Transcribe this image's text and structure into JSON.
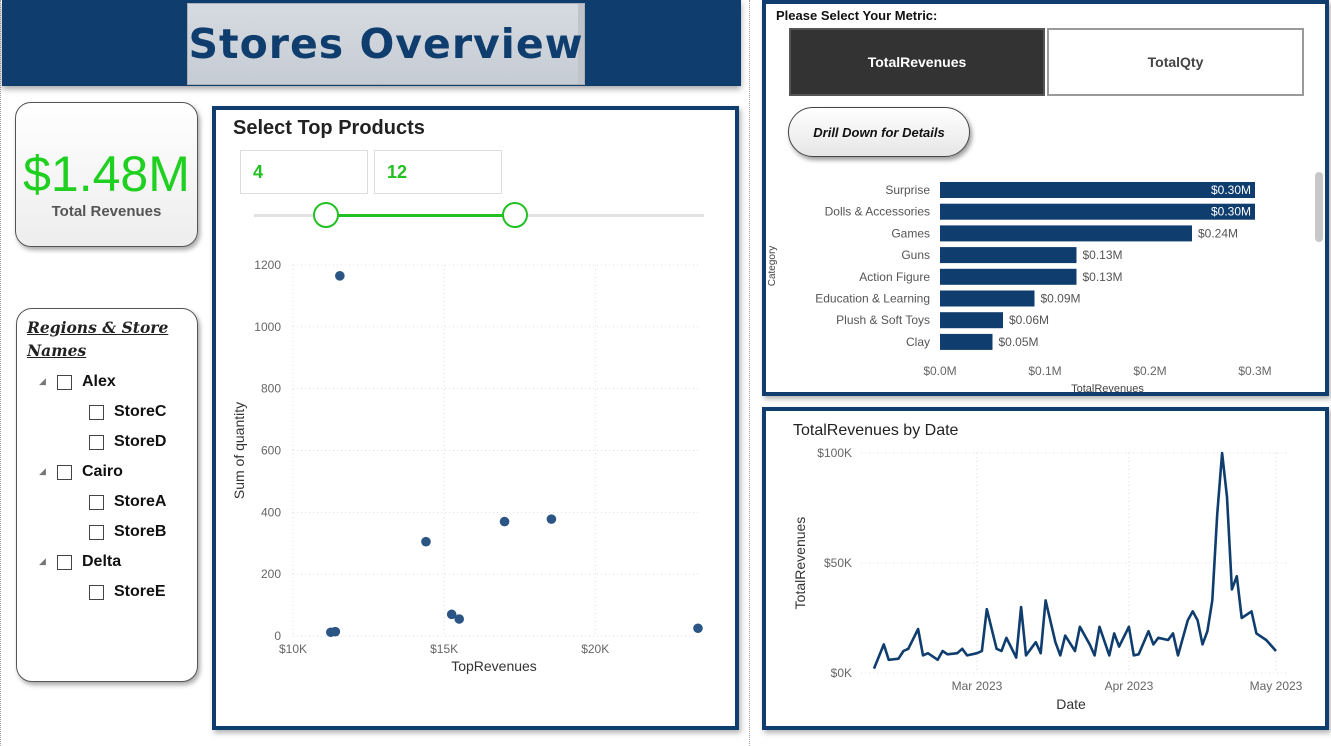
{
  "header": {
    "title": "Stores Overview"
  },
  "kpi": {
    "value": "$1.48M",
    "label": "Total Revenues"
  },
  "slicer": {
    "title": "Regions & Store Names",
    "regions": [
      {
        "name": "Alex",
        "stores": [
          "StoreC",
          "StoreD"
        ]
      },
      {
        "name": "Cairo",
        "stores": [
          "StoreA",
          "StoreB"
        ]
      },
      {
        "name": "Delta",
        "stores": [
          "StoreE"
        ]
      }
    ]
  },
  "top_products": {
    "title": "Select Top Products",
    "range_min": "4",
    "range_max": "12",
    "slider_min_fraction": 0.16,
    "slider_max_fraction": 0.58
  },
  "metric_selector": {
    "prompt": "Please Select Your Metric:",
    "options": [
      "TotalRevenues",
      "TotalQty"
    ],
    "selected": "TotalRevenues",
    "drill_label": "Drill Down for Details"
  },
  "colors": {
    "brand": "#0f3d6e",
    "accent": "#22c022",
    "point": "#2b5584"
  },
  "chart_data": [
    {
      "type": "scatter",
      "xlabel": "TopRevenues",
      "ylabel": "Sum of quantity",
      "xlim": [
        10000,
        23500
      ],
      "ylim": [
        0,
        1200
      ],
      "x_ticks": [
        10000,
        15000,
        20000
      ],
      "x_tick_labels": [
        "$10K",
        "$15K",
        "$20K"
      ],
      "y_ticks": [
        0,
        200,
        400,
        600,
        800,
        1000,
        1200
      ],
      "y_tick_labels": [
        "0",
        "200",
        "400",
        "600",
        "800",
        "1000",
        "1200"
      ],
      "grid": true,
      "points": [
        {
          "x": 11550,
          "y": 1165
        },
        {
          "x": 14400,
          "y": 305
        },
        {
          "x": 17000,
          "y": 370
        },
        {
          "x": 18550,
          "y": 378
        },
        {
          "x": 11250,
          "y": 12
        },
        {
          "x": 11400,
          "y": 14
        },
        {
          "x": 15250,
          "y": 70
        },
        {
          "x": 15500,
          "y": 55
        },
        {
          "x": 23400,
          "y": 25
        }
      ]
    },
    {
      "type": "bar",
      "orientation": "horizontal",
      "xlabel": "TotalRevenues",
      "ylabel": "Category",
      "categories": [
        "Surprise",
        "Dolls & Accessories",
        "Games",
        "Guns",
        "Action Figure",
        "Education & Learning",
        "Plush & Soft Toys",
        "Clay"
      ],
      "values": [
        0.3,
        0.3,
        0.24,
        0.13,
        0.13,
        0.09,
        0.06,
        0.05
      ],
      "value_labels": [
        "$0.30M",
        "$0.30M",
        "$0.24M",
        "$0.13M",
        "$0.13M",
        "$0.09M",
        "$0.06M",
        "$0.05M"
      ],
      "unit": "$M",
      "xlim": [
        0,
        0.3
      ],
      "x_ticks": [
        0,
        0.1,
        0.2,
        0.3
      ],
      "x_tick_labels": [
        "$0.0M",
        "$0.1M",
        "$0.2M",
        "$0.3M"
      ]
    },
    {
      "type": "line",
      "title": "TotalRevenues by Date",
      "xlabel": "Date",
      "ylabel": "TotalRevenues",
      "xlim": [
        "2023-02-08",
        "2023-05-01"
      ],
      "ylim": [
        0,
        100000
      ],
      "x_ticks": [
        "2023-03-01",
        "2023-04-01",
        "2023-05-01"
      ],
      "x_tick_labels": [
        "Mar 2023",
        "Apr 2023",
        "May 2023"
      ],
      "y_ticks": [
        0,
        50000,
        100000
      ],
      "y_tick_labels": [
        "$0K",
        "$50K",
        "$100K"
      ],
      "x": [
        "2023-02-08",
        "2023-02-10",
        "2023-02-11",
        "2023-02-13",
        "2023-02-14",
        "2023-02-15",
        "2023-02-17",
        "2023-02-18",
        "2023-02-19",
        "2023-02-21",
        "2023-02-22",
        "2023-02-23",
        "2023-02-25",
        "2023-02-26",
        "2023-02-27",
        "2023-03-01",
        "2023-03-02",
        "2023-03-03",
        "2023-03-05",
        "2023-03-06",
        "2023-03-07",
        "2023-03-09",
        "2023-03-10",
        "2023-03-11",
        "2023-03-13",
        "2023-03-14",
        "2023-03-15",
        "2023-03-17",
        "2023-03-18",
        "2023-03-19",
        "2023-03-21",
        "2023-03-22",
        "2023-03-24",
        "2023-03-25",
        "2023-03-26",
        "2023-03-28",
        "2023-03-29",
        "2023-03-30",
        "2023-04-01",
        "2023-04-02",
        "2023-04-03",
        "2023-04-05",
        "2023-04-06",
        "2023-04-07",
        "2023-04-09",
        "2023-04-10",
        "2023-04-11",
        "2023-04-13",
        "2023-04-14",
        "2023-04-15",
        "2023-04-16",
        "2023-04-17",
        "2023-04-18",
        "2023-04-19",
        "2023-04-20",
        "2023-04-21",
        "2023-04-22",
        "2023-04-23",
        "2023-04-24",
        "2023-04-26",
        "2023-04-27",
        "2023-04-29",
        "2023-05-01"
      ],
      "y": [
        2000,
        13000,
        6000,
        6500,
        10000,
        11000,
        20000,
        8000,
        9000,
        6000,
        10000,
        8500,
        9000,
        11000,
        8000,
        9000,
        10000,
        29000,
        11000,
        10000,
        16000,
        7000,
        30000,
        8000,
        14000,
        9000,
        33000,
        14000,
        8000,
        17000,
        10000,
        21000,
        13000,
        8000,
        21000,
        8000,
        18000,
        12000,
        21000,
        8000,
        8500,
        19000,
        13000,
        16000,
        15000,
        18000,
        8000,
        24000,
        28000,
        24000,
        13000,
        19000,
        33000,
        72000,
        100000,
        80000,
        38000,
        44000,
        25000,
        28000,
        18000,
        15000,
        10000
      ]
    }
  ]
}
